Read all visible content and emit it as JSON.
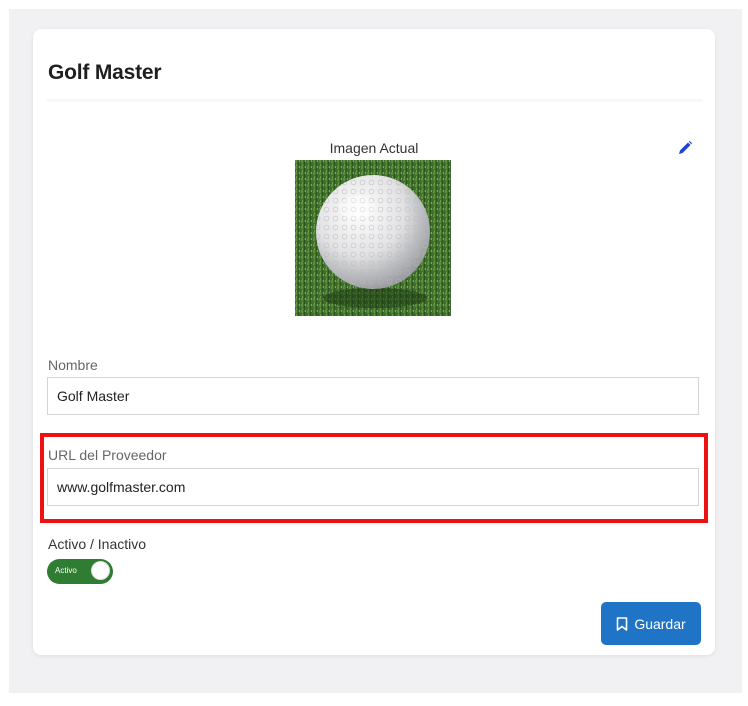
{
  "card": {
    "title": "Golf Master",
    "image_label": "Imagen Actual",
    "edit_icon": "pencil-icon"
  },
  "fields": {
    "name_label": "Nombre",
    "name_value": "Golf Master",
    "url_label": "URL del Proveedor",
    "url_value": "www.golfmaster.com"
  },
  "status": {
    "label": "Activo / Inactivo",
    "toggle_text": "Activo",
    "active": true
  },
  "actions": {
    "save_label": "Guardar",
    "save_icon": "bookmark-icon"
  },
  "colors": {
    "primary": "#1f74c5",
    "toggle_on": "#2e7d32",
    "highlight": "#ee1111",
    "edit_icon": "#1d3fd8"
  }
}
